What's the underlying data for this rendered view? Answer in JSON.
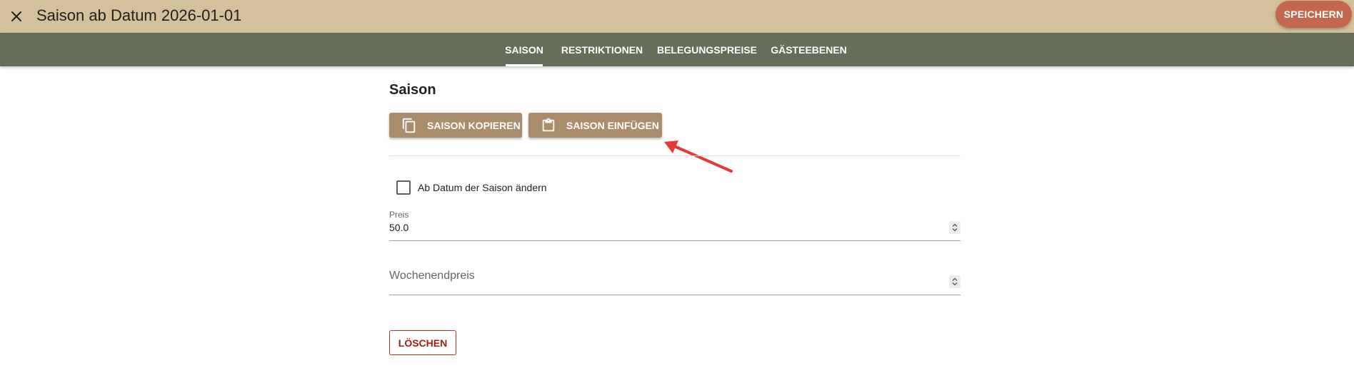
{
  "header": {
    "close_icon": "close-icon",
    "title": "Saison ab Datum 2026-01-01",
    "save_label": "SPEICHERN"
  },
  "tabs": [
    {
      "label": "SAISON",
      "active": true
    },
    {
      "label": "RESTRIKTIONEN",
      "active": false
    },
    {
      "label": "BELEGUNGSPREISE",
      "active": false
    },
    {
      "label": "GÄSTEEBENEN",
      "active": false
    }
  ],
  "main": {
    "section_title": "Saison",
    "copy_button": {
      "label": "SAISON KOPIEREN",
      "icon": "copy-icon"
    },
    "paste_button": {
      "label": "SAISON EINFÜGEN",
      "icon": "clipboard-icon"
    },
    "checkbox": {
      "label": "Ab Datum der Saison ändern",
      "checked": false
    },
    "price_field": {
      "label": "Preis",
      "value": "50.0"
    },
    "weekend_price_field": {
      "placeholder": "Wochenendpreis",
      "value": ""
    },
    "delete_label": "LÖSCHEN"
  },
  "colors": {
    "header_bg": "#d2c19c",
    "tabbar_bg": "#666d58",
    "save_button": "#c4674f",
    "action_button": "#a98d6c",
    "delete_text": "#b01818",
    "annotation_arrow": "#e53935"
  }
}
